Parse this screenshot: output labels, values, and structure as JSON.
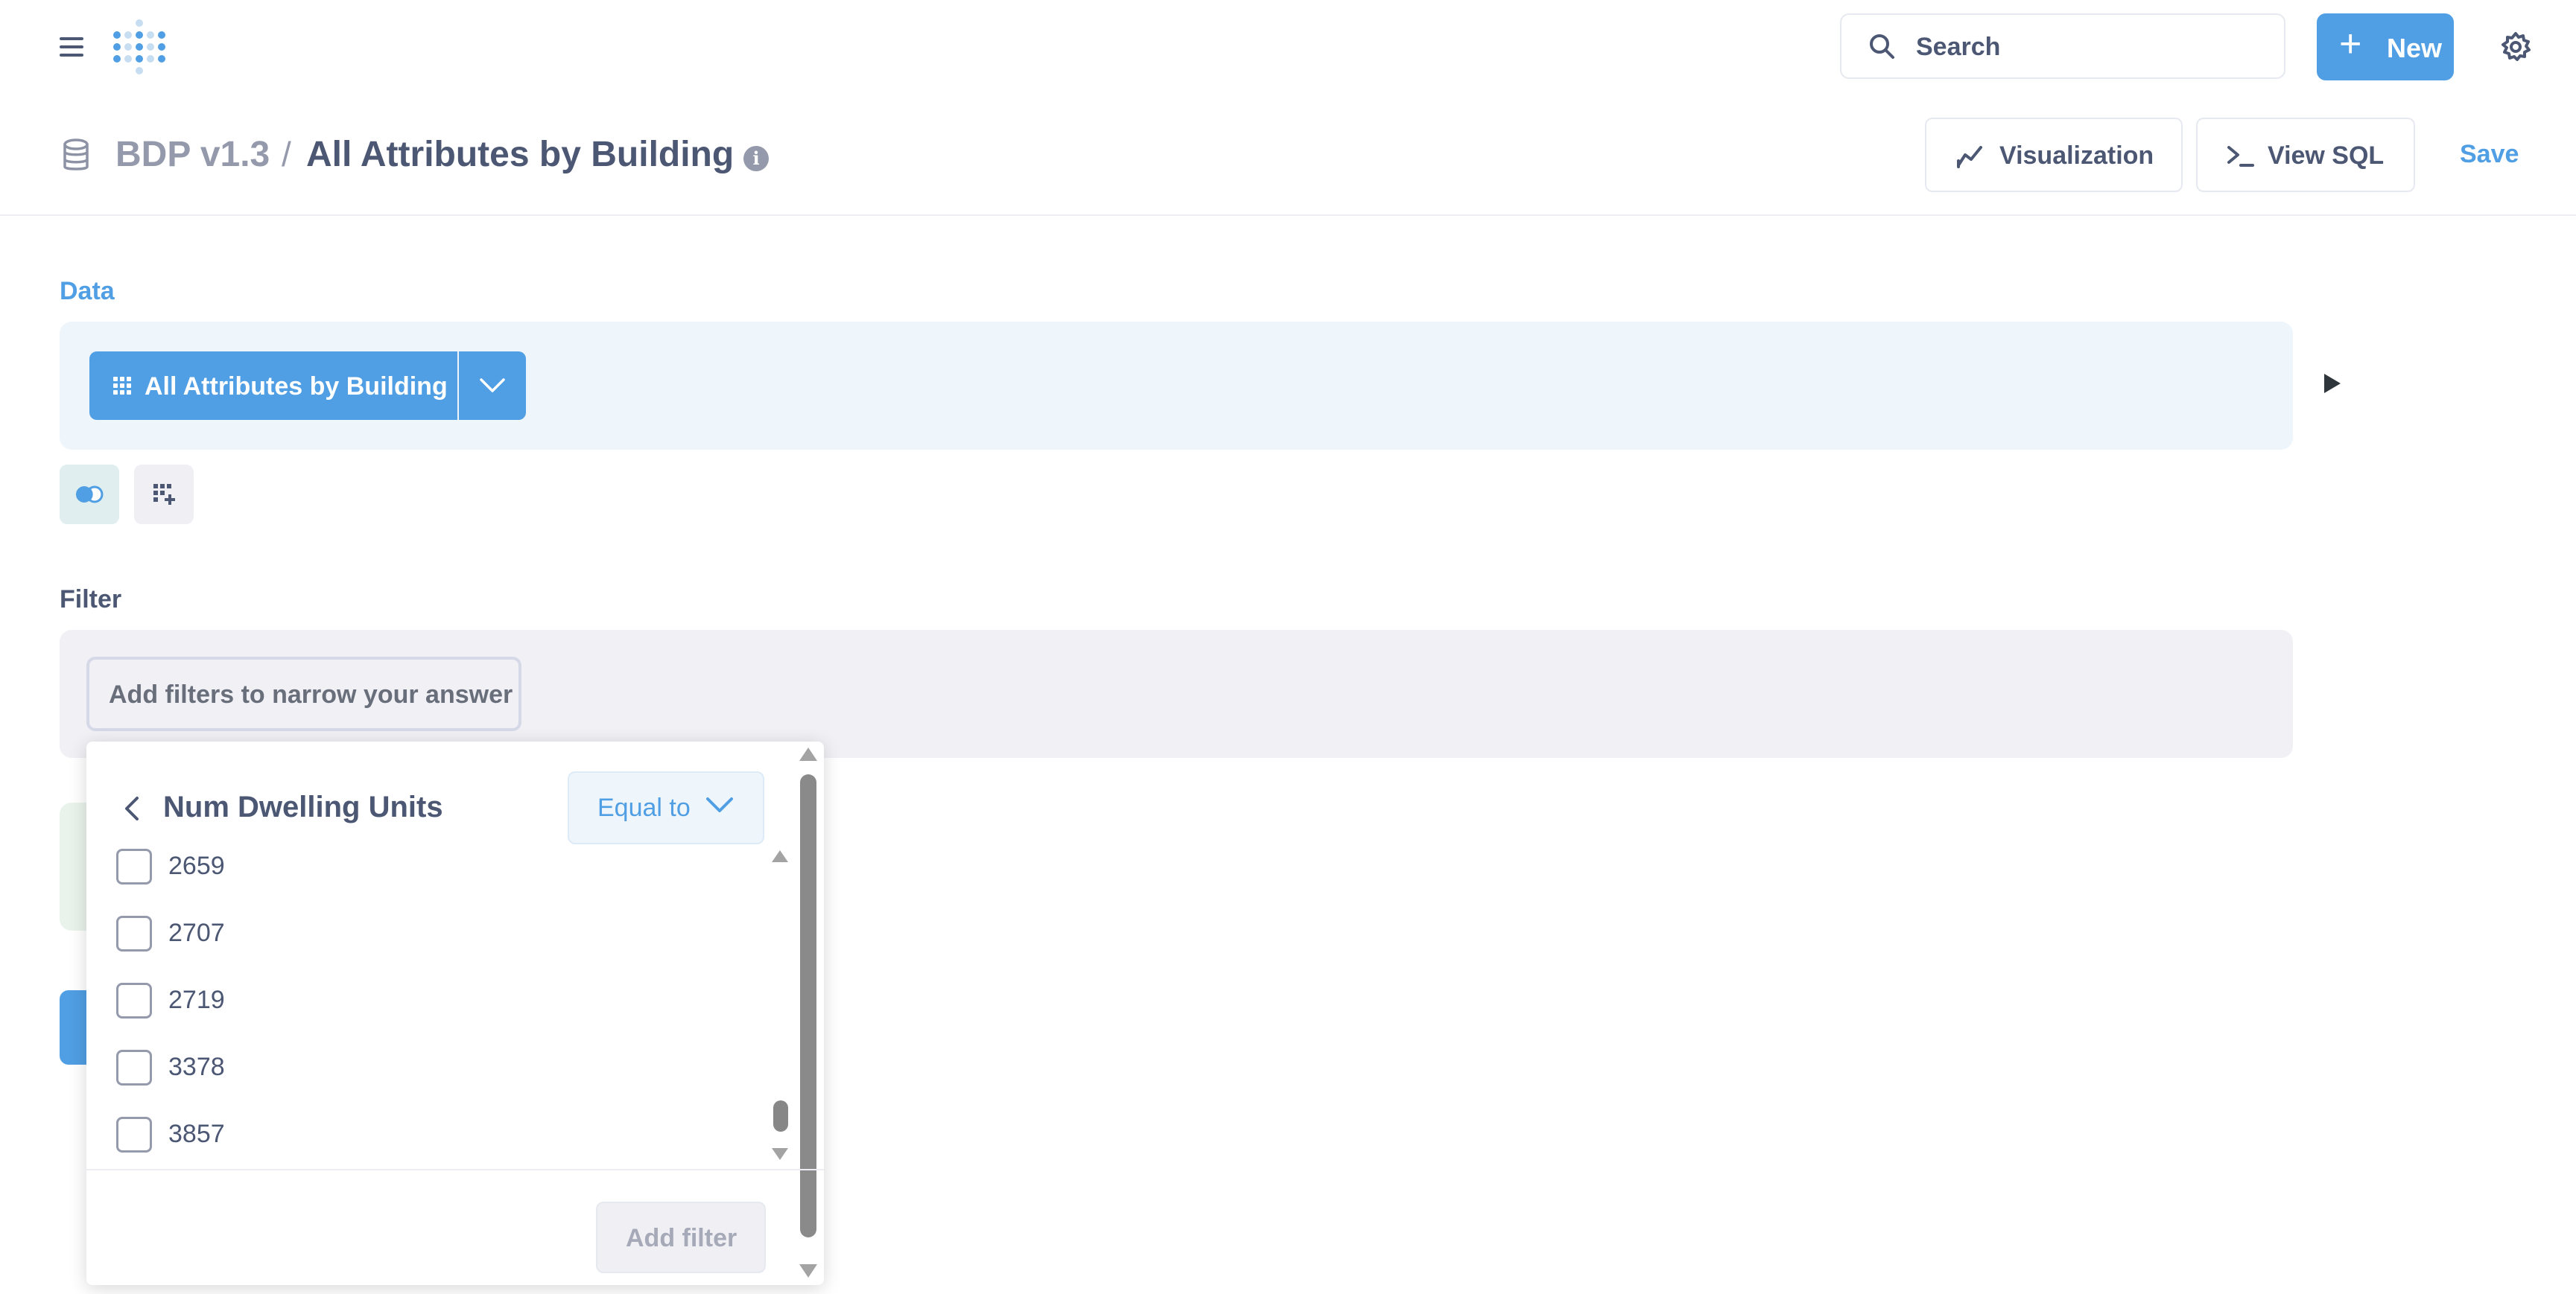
{
  "header": {
    "search_label": "Search",
    "new_label": "New",
    "new_plus": "+"
  },
  "breadcrumb": {
    "database": "BDP v1.3",
    "separator": "/",
    "question": "All Attributes by Building",
    "info_glyph": "i"
  },
  "actions": {
    "visualization": "Visualization",
    "view_sql": "View SQL",
    "save": "Save"
  },
  "notebook": {
    "data_label": "Data",
    "table_name": "All Attributes by Building",
    "filter_label": "Filter",
    "add_filters_placeholder": "Add filters to narrow your answer"
  },
  "filter_popover": {
    "column": "Num Dwelling Units",
    "operator": "Equal to",
    "values": [
      "2659",
      "2707",
      "2719",
      "3378",
      "3857"
    ],
    "submit": "Add filter"
  },
  "colors": {
    "brand": "#509ee3",
    "text": "#4c5773",
    "muted": "#949aab",
    "data_bg": "#eef6fc",
    "filter_bg": "#f0f0f5"
  },
  "icons": [
    "hamburger-icon",
    "metabase-logo",
    "search-icon",
    "plus-icon",
    "gear-icon",
    "database-icon",
    "info-icon",
    "line-chart-icon",
    "terminal-icon",
    "grid-icon",
    "chevron-down-icon",
    "play-icon",
    "join-icon",
    "add-column-icon",
    "chevron-left-icon"
  ]
}
